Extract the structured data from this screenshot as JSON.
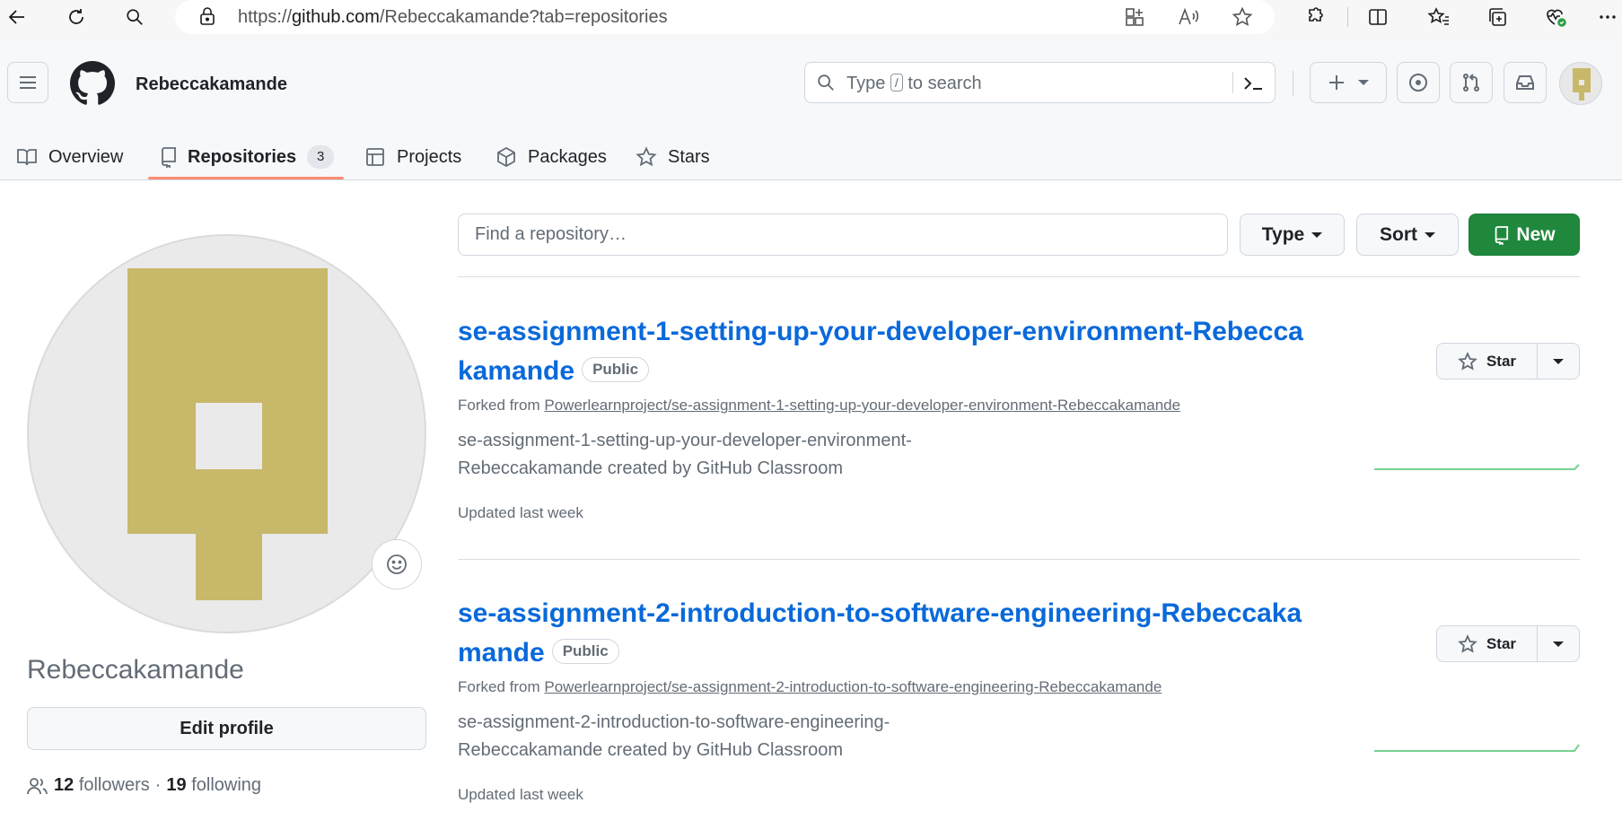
{
  "browser": {
    "url_prefix": "https://",
    "url_domain": "github.com",
    "url_path": "/Rebeccakamande?tab=repositories"
  },
  "header": {
    "username": "Rebeccakamande",
    "search_before": "Type",
    "search_key": "/",
    "search_after": "to search"
  },
  "tabs": [
    {
      "label": "Overview"
    },
    {
      "label": "Repositories",
      "count": "3"
    },
    {
      "label": "Projects"
    },
    {
      "label": "Packages"
    },
    {
      "label": "Stars"
    }
  ],
  "profile": {
    "name": "Rebeccakamande",
    "edit_label": "Edit profile",
    "followers_count": "12",
    "followers_label": "followers",
    "separator": "·",
    "following_count": "19",
    "following_label": "following",
    "avatar_color": "#c8b86a"
  },
  "toolbar": {
    "find_placeholder": "Find a repository…",
    "type_label": "Type",
    "sort_label": "Sort",
    "new_label": "New"
  },
  "repos": [
    {
      "name": "se-assignment-1-setting-up-your-developer-environment-Rebeccakamande",
      "visibility": "Public",
      "forked_prefix": "Forked from",
      "forked_source": "Powerlearnproject/se-assignment-1-setting-up-your-developer-environment-Rebeccakamande",
      "description": "se-assignment-1-setting-up-your-developer-environment-Rebeccakamande created by GitHub Classroom",
      "updated": "Updated last week",
      "star_label": "Star"
    },
    {
      "name": "se-assignment-2-introduction-to-software-engineering-Rebeccakamande",
      "visibility": "Public",
      "forked_prefix": "Forked from",
      "forked_source": "Powerlearnproject/se-assignment-2-introduction-to-software-engineering-Rebeccakamande",
      "description": "se-assignment-2-introduction-to-software-engineering-Rebeccakamande created by GitHub Classroom",
      "updated": "Updated last week",
      "star_label": "Star"
    }
  ],
  "colors": {
    "link": "#0969da",
    "primary_button": "#1f883d",
    "tab_underline": "#fd8c73",
    "sparkline": "#4ac26b"
  }
}
